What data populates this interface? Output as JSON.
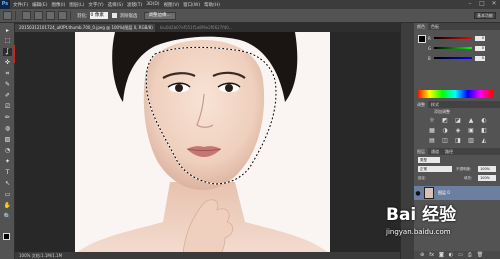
{
  "app": {
    "logo": "Ps"
  },
  "menu": [
    "文件(F)",
    "编辑(E)",
    "图像(I)",
    "图层(L)",
    "文字(Y)",
    "选择(S)",
    "滤镜(T)",
    "3D(D)",
    "视图(V)",
    "窗口(W)",
    "帮助(H)"
  ],
  "window_controls": [
    "–",
    "□",
    "✕"
  ],
  "options_bar": {
    "feather_label": "羽化:",
    "feather_value": "0 像素",
    "antialias_label": "消除锯齿",
    "refine_edge_button": "调整边缘...",
    "workspace": "基本功能"
  },
  "document": {
    "active_tab": "20150312101724_uKfPt.thumb.700_0.jpeg @ 100%(图层 0, RGB/8)",
    "inactive_tab": "kiu0d2b07ef551f5a8f9e2f6627fd0...",
    "status": "100%      文档:1.1M/1.1M"
  },
  "color_panel": {
    "tabs": [
      "颜色",
      "色板"
    ],
    "sliders": [
      {
        "label": "R",
        "value": "0",
        "color": "#d83a3a"
      },
      {
        "label": "G",
        "value": "0",
        "color": "#3aa83a"
      },
      {
        "label": "B",
        "value": "0",
        "color": "#3a58d8"
      }
    ]
  },
  "adjust_panel": {
    "tabs": [
      "调整",
      "样式"
    ],
    "title": "添加调整",
    "icons": [
      "☼",
      "◩",
      "◪",
      "▲",
      "◐",
      "▦",
      "◑",
      "◈",
      "▣",
      "◧",
      "▤",
      "◫",
      "◨",
      "▥",
      "◭"
    ]
  },
  "layers_panel": {
    "tabs": [
      "图层",
      "通道",
      "路径"
    ],
    "kind_label": "类型",
    "blend_mode": "正常",
    "opacity_label": "不透明度:",
    "opacity": "100%",
    "lock_label": "锁定:",
    "fill_label": "填充:",
    "fill": "100%",
    "layer_name": "图层 0",
    "footer_icons": [
      "⊕",
      "fx",
      "◙",
      "◐",
      "▭",
      "⎙",
      "🗑"
    ]
  },
  "tools": [
    "▸",
    "⬚",
    "ʆ",
    "✜",
    "⌗",
    "✎",
    "✐",
    "⎚",
    "✏",
    "◍",
    "▨",
    "◔",
    "✦",
    "T",
    "↖",
    "▭",
    "✋",
    "🔍"
  ],
  "watermark": {
    "logo": "Bai 经验",
    "url": "jingyan.baidu.com"
  }
}
